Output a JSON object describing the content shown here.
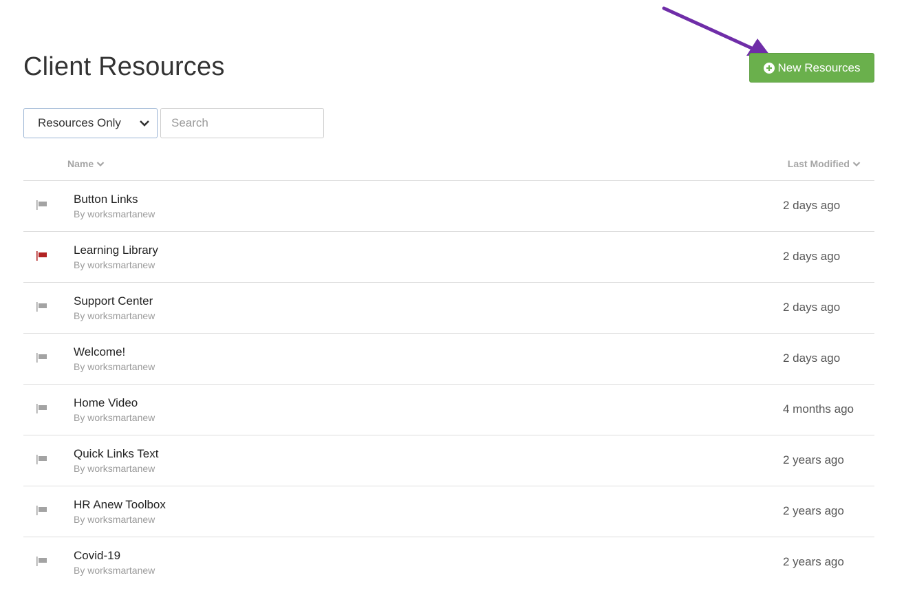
{
  "header": {
    "title": "Client Resources",
    "new_button_label": "New Resources",
    "new_button_icon": "plus-circle-icon",
    "accent_color": "#6ab04c",
    "annotation_arrow_color": "#6f2da8"
  },
  "filters": {
    "type_select_value": "Resources Only",
    "search_placeholder": "Search"
  },
  "table": {
    "col_name": "Name",
    "col_modified": "Last Modified",
    "rows": [
      {
        "name": "Button Links",
        "author": "By worksmartanew",
        "modified": "2 days ago",
        "flag": "gray"
      },
      {
        "name": "Learning Library",
        "author": "By worksmartanew",
        "modified": "2 days ago",
        "flag": "red"
      },
      {
        "name": "Support Center",
        "author": "By worksmartanew",
        "modified": "2 days ago",
        "flag": "gray"
      },
      {
        "name": "Welcome!",
        "author": "By worksmartanew",
        "modified": "2 days ago",
        "flag": "gray"
      },
      {
        "name": "Home Video",
        "author": "By worksmartanew",
        "modified": "4 months ago",
        "flag": "gray"
      },
      {
        "name": "Quick Links Text",
        "author": "By worksmartanew",
        "modified": "2 years ago",
        "flag": "gray"
      },
      {
        "name": "HR Anew Toolbox",
        "author": "By worksmartanew",
        "modified": "2 years ago",
        "flag": "gray"
      },
      {
        "name": "Covid-19",
        "author": "By worksmartanew",
        "modified": "2 years ago",
        "flag": "gray"
      }
    ]
  },
  "colors": {
    "flag_gray": "#a3a3a3",
    "flag_red": "#b22222"
  }
}
